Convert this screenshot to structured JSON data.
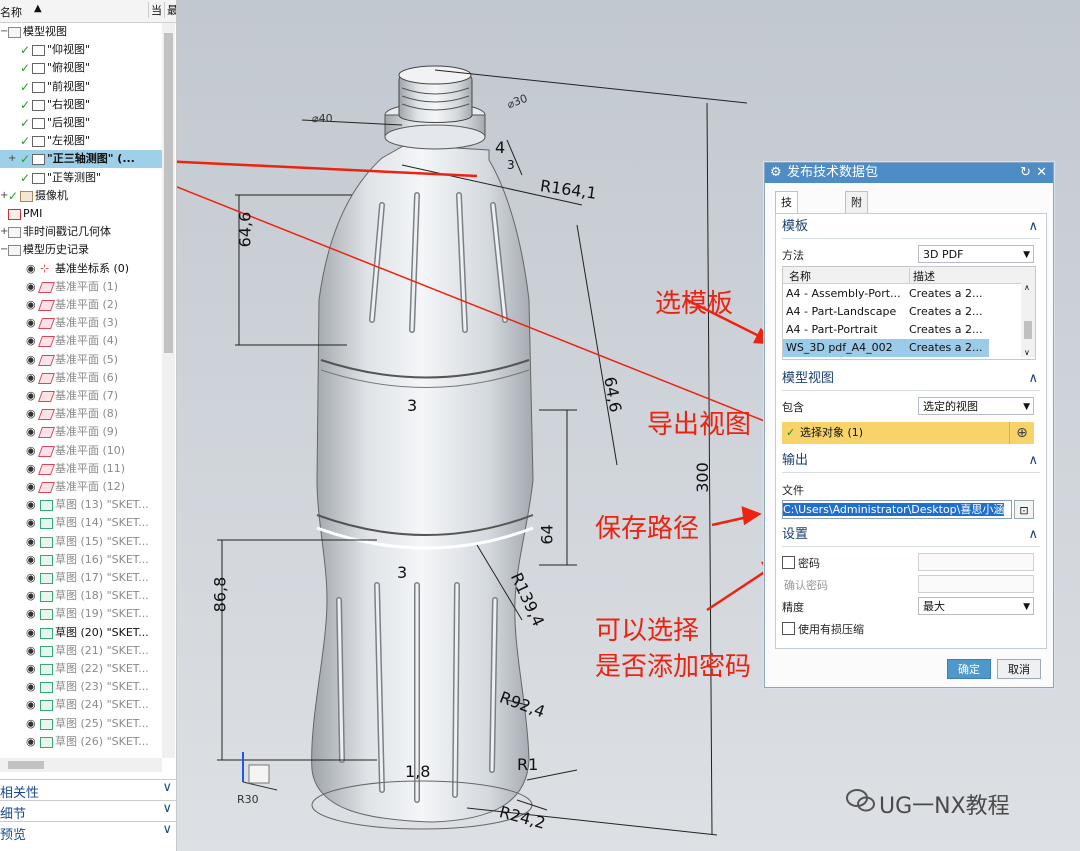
{
  "navigator": {
    "header": {
      "name_col": "名称",
      "col2": "当",
      "col3": "最"
    },
    "tree": [
      {
        "label": "模型视图",
        "kind": "folder",
        "level": 0,
        "exp": "-"
      },
      {
        "label": "\"仰视图\"",
        "kind": "view",
        "level": 1,
        "check": true
      },
      {
        "label": "\"俯视图\"",
        "kind": "view",
        "level": 1,
        "check": true
      },
      {
        "label": "\"前视图\"",
        "kind": "view",
        "level": 1,
        "check": true
      },
      {
        "label": "\"右视图\"",
        "kind": "view",
        "level": 1,
        "check": true
      },
      {
        "label": "\"后视图\"",
        "kind": "view",
        "level": 1,
        "check": true
      },
      {
        "label": "\"左视图\"",
        "kind": "view",
        "level": 1,
        "check": true
      },
      {
        "label": "\"正三轴测图\" (...",
        "kind": "view",
        "level": 1,
        "check": true,
        "selected": true,
        "exp": "+"
      },
      {
        "label": "\"正等测图\"",
        "kind": "view",
        "level": 1,
        "check": true
      },
      {
        "label": "摄像机",
        "kind": "camera",
        "level": 0,
        "check": true,
        "exp": "+"
      },
      {
        "label": "PMI",
        "kind": "pmi",
        "level": 0
      },
      {
        "label": "非时间戳记几何体",
        "kind": "folder",
        "level": 0,
        "exp": "+"
      },
      {
        "label": "模型历史记录",
        "kind": "folder",
        "level": 0,
        "exp": "-"
      },
      {
        "label": "基准坐标系 (0)",
        "kind": "csys",
        "level": 1,
        "eye": true
      },
      {
        "label": "基准平面 (1)",
        "kind": "plane",
        "level": 1,
        "eye": true,
        "gray": true
      },
      {
        "label": "基准平面 (2)",
        "kind": "plane",
        "level": 1,
        "eye": true,
        "gray": true
      },
      {
        "label": "基准平面 (3)",
        "kind": "plane",
        "level": 1,
        "eye": true,
        "gray": true
      },
      {
        "label": "基准平面 (4)",
        "kind": "plane",
        "level": 1,
        "eye": true,
        "gray": true
      },
      {
        "label": "基准平面 (5)",
        "kind": "plane",
        "level": 1,
        "eye": true,
        "gray": true
      },
      {
        "label": "基准平面 (6)",
        "kind": "plane",
        "level": 1,
        "eye": true,
        "gray": true
      },
      {
        "label": "基准平面 (7)",
        "kind": "plane",
        "level": 1,
        "eye": true,
        "gray": true
      },
      {
        "label": "基准平面 (8)",
        "kind": "plane",
        "level": 1,
        "eye": true,
        "gray": true
      },
      {
        "label": "基准平面 (9)",
        "kind": "plane",
        "level": 1,
        "eye": true,
        "gray": true
      },
      {
        "label": "基准平面 (10)",
        "kind": "plane",
        "level": 1,
        "eye": true,
        "gray": true
      },
      {
        "label": "基准平面 (11)",
        "kind": "plane",
        "level": 1,
        "eye": true,
        "gray": true
      },
      {
        "label": "基准平面 (12)",
        "kind": "plane",
        "level": 1,
        "eye": true,
        "gray": true
      },
      {
        "label": "草图 (13) \"SKET...",
        "kind": "sketch",
        "level": 1,
        "eye": true,
        "gray": true
      },
      {
        "label": "草图 (14) \"SKET...",
        "kind": "sketch",
        "level": 1,
        "eye": true,
        "gray": true
      },
      {
        "label": "草图 (15) \"SKET...",
        "kind": "sketch",
        "level": 1,
        "eye": true,
        "gray": true
      },
      {
        "label": "草图 (16) \"SKET...",
        "kind": "sketch",
        "level": 1,
        "eye": true,
        "gray": true
      },
      {
        "label": "草图 (17) \"SKET...",
        "kind": "sketch",
        "level": 1,
        "eye": true,
        "gray": true
      },
      {
        "label": "草图 (18) \"SKET...",
        "kind": "sketch",
        "level": 1,
        "eye": true,
        "gray": true
      },
      {
        "label": "草图 (19) \"SKET...",
        "kind": "sketch",
        "level": 1,
        "eye": true,
        "gray": true
      },
      {
        "label": "草图 (20) \"SKET...",
        "kind": "sketch",
        "level": 1,
        "eye": true,
        "gray": false
      },
      {
        "label": "草图 (21) \"SKET...",
        "kind": "sketch",
        "level": 1,
        "eye": true,
        "gray": true
      },
      {
        "label": "草图 (22) \"SKET...",
        "kind": "sketch",
        "level": 1,
        "eye": true,
        "gray": true
      },
      {
        "label": "草图 (23) \"SKET...",
        "kind": "sketch",
        "level": 1,
        "eye": true,
        "gray": true
      },
      {
        "label": "草图 (24) \"SKET...",
        "kind": "sketch",
        "level": 1,
        "eye": true,
        "gray": true
      },
      {
        "label": "草图 (25) \"SKET...",
        "kind": "sketch",
        "level": 1,
        "eye": true,
        "gray": true
      },
      {
        "label": "草图 (26) \"SKET...",
        "kind": "sketch",
        "level": 1,
        "eye": true,
        "gray": true
      }
    ],
    "panels": [
      {
        "label": "相关性"
      },
      {
        "label": "细节"
      },
      {
        "label": "预览"
      }
    ]
  },
  "viewport": {
    "dimensions": {
      "d_neck": "⌀30",
      "d_top": "⌀40",
      "d4": "4",
      "d3a": "3",
      "r164": "R164,1",
      "d646a": "64,6",
      "d646b": "64,6",
      "d3b": "3",
      "d300": "300",
      "d64": "64",
      "d868": "86,8",
      "d3c": "3",
      "r1394": "R139,4",
      "r924": "R92,4",
      "d18": "1,8",
      "r1": "R1",
      "r242": "R24,2",
      "rr30": "R30"
    },
    "annotations": {
      "template": "选模板",
      "export_view": "导出视图",
      "save_path": "保存路径",
      "password_line1": "可以选择",
      "password_line2": "是否添加密码"
    },
    "annotation_color": "#ee2211",
    "watermark": "UG一NX教程"
  },
  "dialog": {
    "title": "发布技术数据包",
    "tabs": [
      "技术数据包",
      "附件"
    ],
    "template_section": {
      "title": "模板",
      "method_label": "方法",
      "method_value": "3D PDF",
      "columns": [
        "名称",
        "描述"
      ],
      "rows": [
        {
          "name": "A4 - Assembly-Port...",
          "desc": "Creates a 2..."
        },
        {
          "name": "A4 - Part-Landscape",
          "desc": "Creates a 2..."
        },
        {
          "name": "A4 - Part-Portrait",
          "desc": "Creates a 2..."
        },
        {
          "name": "WS_3D pdf_A4_002",
          "desc": "Creates a 2...",
          "selected": true
        }
      ]
    },
    "view_section": {
      "title": "模型视图",
      "include_label": "包含",
      "include_value": "选定的视图",
      "select_object": "选择对象 (1)"
    },
    "output_section": {
      "title": "输出",
      "file_label": "文件",
      "file_value": "C:\\Users\\Administrator\\Desktop\\喜思小涵"
    },
    "settings_section": {
      "title": "设置",
      "password_label": "密码",
      "confirm_label": "确认密码",
      "precision_label": "精度",
      "precision_value": "最大",
      "lossy_label": "使用有损压缩"
    },
    "ok_label": "确定",
    "cancel_label": "取消"
  }
}
